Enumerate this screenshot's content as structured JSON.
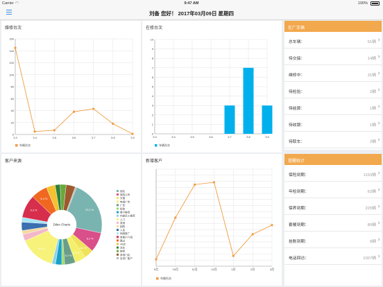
{
  "status_bar": {
    "carrier": "Carrier",
    "time": "9:47 AM",
    "battery": "100%"
  },
  "nav": {
    "title": "刘备 您好！    2017年03月09日 星期四"
  },
  "panels": {
    "repair": {
      "title": "维修台次",
      "legend": "车辆台次"
    },
    "inrepair": {
      "title": "在修台次",
      "legend": "车辆台次"
    },
    "source": {
      "title": "客户来源",
      "center": "Dilen Charts"
    },
    "newcust": {
      "title": "新增客户",
      "legend": "车辆台次"
    }
  },
  "side1": {
    "title": "在厂车辆",
    "rows": [
      {
        "label": "总车辆：",
        "value": "51辆"
      },
      {
        "label": "待交接：",
        "value": "14辆"
      },
      {
        "label": "维修中：",
        "value": "31辆"
      },
      {
        "label": "待检验：",
        "value": "2辆"
      },
      {
        "label": "待结算：",
        "value": "1辆"
      },
      {
        "label": "待收银：",
        "value": "1辆"
      },
      {
        "label": "待取车：",
        "value": "2辆"
      }
    ]
  },
  "side2": {
    "title": "提醒统计",
    "rows": [
      {
        "label": "保险到期：",
        "value": "1153辆"
      },
      {
        "label": "年检到期：",
        "value": "62辆"
      },
      {
        "label": "保养到期：",
        "value": "225辆"
      },
      {
        "label": "套餐到期：",
        "value": "80辆"
      },
      {
        "label": "挂账到期：",
        "value": "9辆"
      },
      {
        "label": "电话回访：",
        "value": "1007辆"
      }
    ]
  },
  "colors": {
    "orange": "#f19a3e",
    "blue": "#00b0ec",
    "accent": "#f2a84c"
  },
  "chart_data": [
    {
      "type": "line",
      "title": "维修台次",
      "x": [
        "3.3",
        "3.4",
        "3.5",
        "3.6",
        "3.7",
        "3.8",
        "3.9"
      ],
      "series": [
        {
          "name": "车辆台次",
          "values": [
            145,
            5,
            7,
            38,
            43,
            18,
            1
          ]
        }
      ],
      "ylim": [
        0,
        160
      ],
      "yticks": [
        "0",
        "20",
        "40",
        "60",
        "80",
        "100",
        "120",
        "140",
        "160"
      ]
    },
    {
      "type": "bar",
      "title": "在修台次",
      "categories": [
        "3.3",
        "3.4",
        "3.5",
        "3.6",
        "3.7",
        "3.8",
        "3.9"
      ],
      "series": [
        {
          "name": "车辆台次",
          "values": [
            0,
            0,
            0,
            0,
            3,
            7,
            3
          ]
        }
      ],
      "ylim": [
        0,
        10
      ],
      "yticks": [
        "0",
        "1",
        "2",
        "3",
        "4",
        "5",
        "6",
        "7",
        "8",
        "9",
        "10"
      ]
    },
    {
      "type": "pie",
      "title": "客户来源",
      "slices": [
        {
          "label": "朋友",
          "value": 23.1,
          "color": "#7ab4b0"
        },
        {
          "label": "保险公司",
          "value": 8.2,
          "color": "#d94f8a"
        },
        {
          "label": "天猫",
          "value": 3.9,
          "color": "#f0e25a"
        },
        {
          "label": "电视广告",
          "value": 4.6,
          "color": "#f4f06a"
        },
        {
          "label": "广告",
          "value": 4.5,
          "color": "#6a9e8a"
        },
        {
          "label": "短信",
          "value": 1.2,
          "color": "#9ed66a"
        },
        {
          "label": "客户推荐",
          "value": 2.6,
          "color": "#1aa0c8"
        },
        {
          "label": "内部员工推荐",
          "value": 1.5,
          "color": "#8bd4e8"
        },
        {
          "label": "上门",
          "value": 14.9,
          "color": "#f7f27a"
        },
        {
          "label": "其他",
          "value": 2.8,
          "color": "#f3b7c9"
        },
        {
          "label": "团购",
          "value": 1.6,
          "color": "#f4d9a0"
        },
        {
          "label": "入会",
          "value": 3.5,
          "color": "#3a6fb0"
        },
        {
          "label": "网络推广",
          "value": 2.0,
          "color": "#a8e4f4"
        },
        {
          "label": "老客户介绍",
          "value": 9.6,
          "color": "#d62e4c"
        },
        {
          "label": "路过",
          "value": 6.8,
          "color": "#f06820"
        },
        {
          "label": "4S店",
          "value": 3.7,
          "color": "#f2c230"
        },
        {
          "label": "洗车",
          "value": 2.1,
          "color": "#2e7f3a"
        },
        {
          "label": "维修",
          "value": 2.5,
          "color": "#6aa83c"
        },
        {
          "label": "其他门店",
          "value": 3.8,
          "color": "#9c5a2e"
        },
        {
          "label": "自来厂客户",
          "value": 0.6,
          "color": "#b8b8b8"
        }
      ],
      "legend": [
        "朋友",
        "保险公司",
        "天猫",
        "电视广告",
        "广告",
        "短信",
        "客户推荐",
        "内部员工推荐",
        "上门",
        "其他",
        "团购",
        "入会",
        "网络推广",
        "老客户介绍",
        "路过",
        "4S店",
        "洗车",
        "维修",
        "其他门店",
        "自来厂客户"
      ],
      "labels": [
        "23.1 %",
        "8.2 %",
        "9.6 %",
        "9.6 %",
        "5.2 %",
        "8.3 %",
        "6.3 %",
        "6.4 %",
        "5.0 %",
        "4.5 %"
      ]
    },
    {
      "type": "line",
      "title": "新增客户",
      "x": [
        "9月",
        "10月",
        "11月",
        "12月",
        "1月",
        "2月",
        "3月"
      ],
      "series": [
        {
          "name": "车辆台次",
          "values": [
            2,
            75,
            133,
            137,
            8,
            46,
            62
          ]
        }
      ],
      "ylim": [
        -10,
        160
      ],
      "yticks": [
        "",
        "",
        "",
        "",
        "",
        "",
        "",
        "",
        "",
        "",
        "",
        "",
        "",
        "",
        "",
        "",
        ""
      ]
    }
  ]
}
